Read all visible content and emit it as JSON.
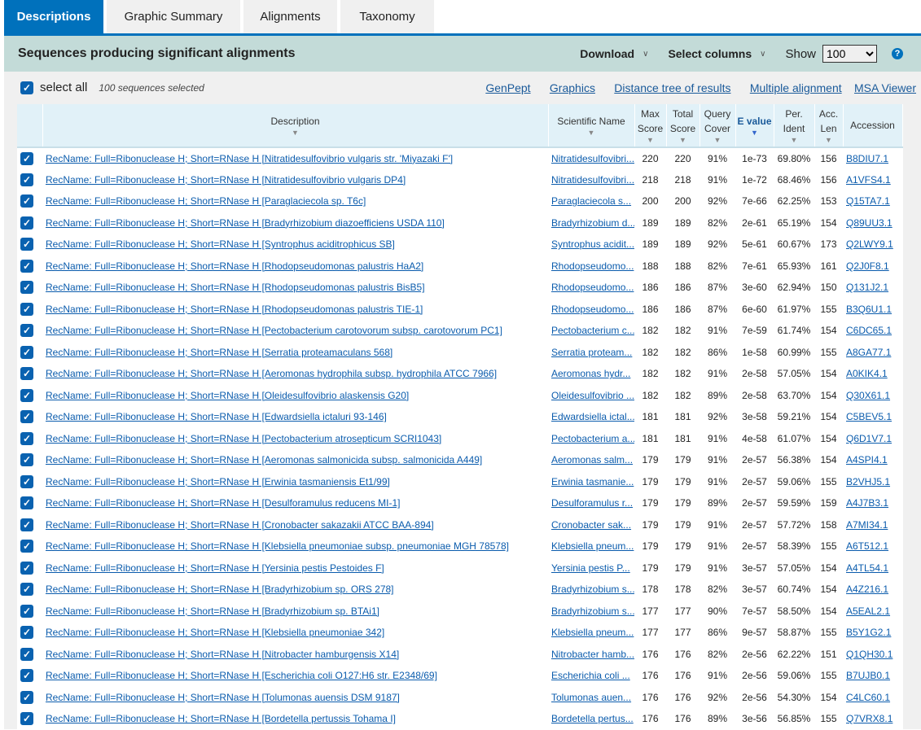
{
  "tabs": [
    "Descriptions",
    "Graphic Summary",
    "Alignments",
    "Taxonomy"
  ],
  "header": {
    "title": "Sequences producing significant alignments",
    "download": "Download",
    "select_columns": "Select columns",
    "show_label": "Show",
    "show_value": "100",
    "help": "?"
  },
  "selection": {
    "select_all": "select all",
    "count": "100 sequences selected"
  },
  "links": [
    "GenPept",
    "Graphics",
    "Distance tree of results",
    "Multiple alignment",
    "MSA Viewer"
  ],
  "columns": [
    {
      "label": "Description"
    },
    {
      "label": "Scientific Name"
    },
    {
      "label": "Max Score"
    },
    {
      "label": "Total Score"
    },
    {
      "label": "Query Cover"
    },
    {
      "label": "E value",
      "sorted": true
    },
    {
      "label": "Per. Ident"
    },
    {
      "label": "Acc. Len"
    },
    {
      "label": "Accession"
    }
  ],
  "colors": {
    "accent": "#0071bc",
    "header_bar": "#c3dbd8",
    "link": "#0b5cad"
  },
  "rows": [
    [
      "RecName: Full=Ribonuclease H; Short=RNase H [Nitratidesulfovibrio vulgaris str. 'Miyazaki F']",
      "Nitratidesulfovibri...",
      "220",
      "220",
      "91%",
      "1e-73",
      "69.80%",
      "156",
      "B8DIU7.1"
    ],
    [
      "RecName: Full=Ribonuclease H; Short=RNase H [Nitratidesulfovibrio vulgaris DP4]",
      "Nitratidesulfovibri...",
      "218",
      "218",
      "91%",
      "1e-72",
      "68.46%",
      "156",
      "A1VFS4.1"
    ],
    [
      "RecName: Full=Ribonuclease H; Short=RNase H [Paraglaciecola sp. T6c]",
      "Paraglaciecola s...",
      "200",
      "200",
      "92%",
      "7e-66",
      "62.25%",
      "153",
      "Q15TA7.1"
    ],
    [
      "RecName: Full=Ribonuclease H; Short=RNase H [Bradyrhizobium diazoefficiens USDA 110]",
      "Bradyrhizobium d...",
      "189",
      "189",
      "82%",
      "2e-61",
      "65.19%",
      "154",
      "Q89UU3.1"
    ],
    [
      "RecName: Full=Ribonuclease H; Short=RNase H [Syntrophus aciditrophicus SB]",
      "Syntrophus acidit...",
      "189",
      "189",
      "92%",
      "5e-61",
      "60.67%",
      "173",
      "Q2LWY9.1"
    ],
    [
      "RecName: Full=Ribonuclease H; Short=RNase H [Rhodopseudomonas palustris HaA2]",
      "Rhodopseudomo...",
      "188",
      "188",
      "82%",
      "7e-61",
      "65.93%",
      "161",
      "Q2J0F8.1"
    ],
    [
      "RecName: Full=Ribonuclease H; Short=RNase H [Rhodopseudomonas palustris BisB5]",
      "Rhodopseudomo...",
      "186",
      "186",
      "87%",
      "3e-60",
      "62.94%",
      "150",
      "Q131J2.1"
    ],
    [
      "RecName: Full=Ribonuclease H; Short=RNase H [Rhodopseudomonas palustris TIE-1]",
      "Rhodopseudomo...",
      "186",
      "186",
      "87%",
      "6e-60",
      "61.97%",
      "155",
      "B3Q6U1.1"
    ],
    [
      "RecName: Full=Ribonuclease H; Short=RNase H [Pectobacterium carotovorum subsp. carotovorum PC1]",
      "Pectobacterium c...",
      "182",
      "182",
      "91%",
      "7e-59",
      "61.74%",
      "154",
      "C6DC65.1"
    ],
    [
      "RecName: Full=Ribonuclease H; Short=RNase H [Serratia proteamaculans 568]",
      "Serratia proteam...",
      "182",
      "182",
      "86%",
      "1e-58",
      "60.99%",
      "155",
      "A8GA77.1"
    ],
    [
      "RecName: Full=Ribonuclease H; Short=RNase H [Aeromonas hydrophila subsp. hydrophila ATCC 7966]",
      "Aeromonas hydr...",
      "182",
      "182",
      "91%",
      "2e-58",
      "57.05%",
      "154",
      "A0KIK4.1"
    ],
    [
      "RecName: Full=Ribonuclease H; Short=RNase H [Oleidesulfovibrio alaskensis G20]",
      "Oleidesulfovibrio ...",
      "182",
      "182",
      "89%",
      "2e-58",
      "63.70%",
      "154",
      "Q30X61.1"
    ],
    [
      "RecName: Full=Ribonuclease H; Short=RNase H [Edwardsiella ictaluri 93-146]",
      "Edwardsiella ictal...",
      "181",
      "181",
      "92%",
      "3e-58",
      "59.21%",
      "154",
      "C5BEV5.1"
    ],
    [
      "RecName: Full=Ribonuclease H; Short=RNase H [Pectobacterium atrosepticum SCRI1043]",
      "Pectobacterium a...",
      "181",
      "181",
      "91%",
      "4e-58",
      "61.07%",
      "154",
      "Q6D1V7.1"
    ],
    [
      "RecName: Full=Ribonuclease H; Short=RNase H [Aeromonas salmonicida subsp. salmonicida A449]",
      "Aeromonas salm...",
      "179",
      "179",
      "91%",
      "2e-57",
      "56.38%",
      "154",
      "A4SPI4.1"
    ],
    [
      "RecName: Full=Ribonuclease H; Short=RNase H [Erwinia tasmaniensis Et1/99]",
      "Erwinia tasmanie...",
      "179",
      "179",
      "91%",
      "2e-57",
      "59.06%",
      "155",
      "B2VHJ5.1"
    ],
    [
      "RecName: Full=Ribonuclease H; Short=RNase H [Desulforamulus reducens MI-1]",
      "Desulforamulus r...",
      "179",
      "179",
      "89%",
      "2e-57",
      "59.59%",
      "159",
      "A4J7B3.1"
    ],
    [
      "RecName: Full=Ribonuclease H; Short=RNase H [Cronobacter sakazakii ATCC BAA-894]",
      "Cronobacter sak...",
      "179",
      "179",
      "91%",
      "2e-57",
      "57.72%",
      "158",
      "A7MI34.1"
    ],
    [
      "RecName: Full=Ribonuclease H; Short=RNase H [Klebsiella pneumoniae subsp. pneumoniae MGH 78578]",
      "Klebsiella pneum...",
      "179",
      "179",
      "91%",
      "2e-57",
      "58.39%",
      "155",
      "A6T512.1"
    ],
    [
      "RecName: Full=Ribonuclease H; Short=RNase H [Yersinia pestis Pestoides F]",
      "Yersinia pestis P...",
      "179",
      "179",
      "91%",
      "3e-57",
      "57.05%",
      "154",
      "A4TL54.1"
    ],
    [
      "RecName: Full=Ribonuclease H; Short=RNase H [Bradyrhizobium sp. ORS 278]",
      "Bradyrhizobium s...",
      "178",
      "178",
      "82%",
      "3e-57",
      "60.74%",
      "154",
      "A4Z216.1"
    ],
    [
      "RecName: Full=Ribonuclease H; Short=RNase H [Bradyrhizobium sp. BTAi1]",
      "Bradyrhizobium s...",
      "177",
      "177",
      "90%",
      "7e-57",
      "58.50%",
      "154",
      "A5EAL2.1"
    ],
    [
      "RecName: Full=Ribonuclease H; Short=RNase H [Klebsiella pneumoniae 342]",
      "Klebsiella pneum...",
      "177",
      "177",
      "86%",
      "9e-57",
      "58.87%",
      "155",
      "B5Y1G2.1"
    ],
    [
      "RecName: Full=Ribonuclease H; Short=RNase H [Nitrobacter hamburgensis X14]",
      "Nitrobacter hamb...",
      "176",
      "176",
      "82%",
      "2e-56",
      "62.22%",
      "151",
      "Q1QH30.1"
    ],
    [
      "RecName: Full=Ribonuclease H; Short=RNase H [Escherichia coli O127:H6 str. E2348/69]",
      "Escherichia coli ...",
      "176",
      "176",
      "91%",
      "2e-56",
      "59.06%",
      "155",
      "B7UJB0.1"
    ],
    [
      "RecName: Full=Ribonuclease H; Short=RNase H [Tolumonas auensis DSM 9187]",
      "Tolumonas auen...",
      "176",
      "176",
      "92%",
      "2e-56",
      "54.30%",
      "154",
      "C4LC60.1"
    ],
    [
      "RecName: Full=Ribonuclease H; Short=RNase H [Bordetella pertussis Tohama I]",
      "Bordetella pertus...",
      "176",
      "176",
      "89%",
      "3e-56",
      "56.85%",
      "155",
      "Q7VRX8.1"
    ]
  ]
}
